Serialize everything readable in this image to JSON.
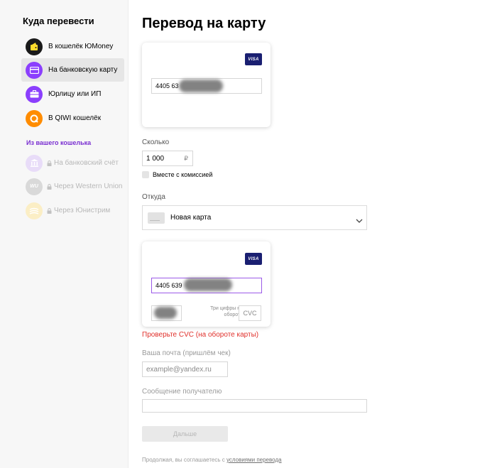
{
  "sidebar": {
    "title": "Куда перевести",
    "items": [
      {
        "label": "В кошелёк ЮMoney",
        "icon": "yoomoney-wallet-icon",
        "color": "#ffdd2d",
        "bg": "#1a1a1a"
      },
      {
        "label": "На банковскую карту",
        "icon": "bank-card-icon",
        "color": "#ffffff",
        "bg": "#8b3ffd"
      },
      {
        "label": "Юрлицу или ИП",
        "icon": "briefcase-icon",
        "color": "#ffffff",
        "bg": "#8b3ffd"
      },
      {
        "label": "В QIWI кошелёк",
        "icon": "qiwi-icon",
        "color": "#ffffff",
        "bg": "#ff8c00"
      }
    ],
    "section_title": "Из вашего кошелька",
    "wallet_items": [
      {
        "label": "На банковский счёт",
        "icon": "bank-building-icon"
      },
      {
        "label": "Через Western Union",
        "icon": "western-union-icon",
        "badge": "WU"
      },
      {
        "label": "Через Юнистрим",
        "icon": "unistream-icon"
      }
    ]
  },
  "main": {
    "title": "Перевод на карту",
    "recipient_card": {
      "brand": "VISA",
      "number_visible": "4405 63"
    },
    "amount": {
      "label": "Сколько",
      "value": "1 000",
      "currency": "₽"
    },
    "commission_checkbox": {
      "label": "Вместе с комиссией",
      "checked": false
    },
    "source": {
      "label": "Откуда",
      "selected": "Новая карта"
    },
    "sender_card": {
      "brand": "VISA",
      "number_visible": "4405 639",
      "cvc_hint": "Три цифры на обороте",
      "cvc_placeholder": "CVC"
    },
    "error": "Проверьте CVC (на обороте карты)",
    "email": {
      "label": "Ваша почта (пришлём чек)",
      "placeholder": "example@yandex.ru"
    },
    "message": {
      "label": "Сообщение получателю",
      "placeholder": ""
    },
    "submit_label": "Дальше",
    "footer_text": "Продолжая, вы соглашаетесь с ",
    "footer_link": "условиями перевода"
  },
  "colors": {
    "accent": "#8b3ffd",
    "error": "#e0302b",
    "visa": "#1a1f71"
  }
}
